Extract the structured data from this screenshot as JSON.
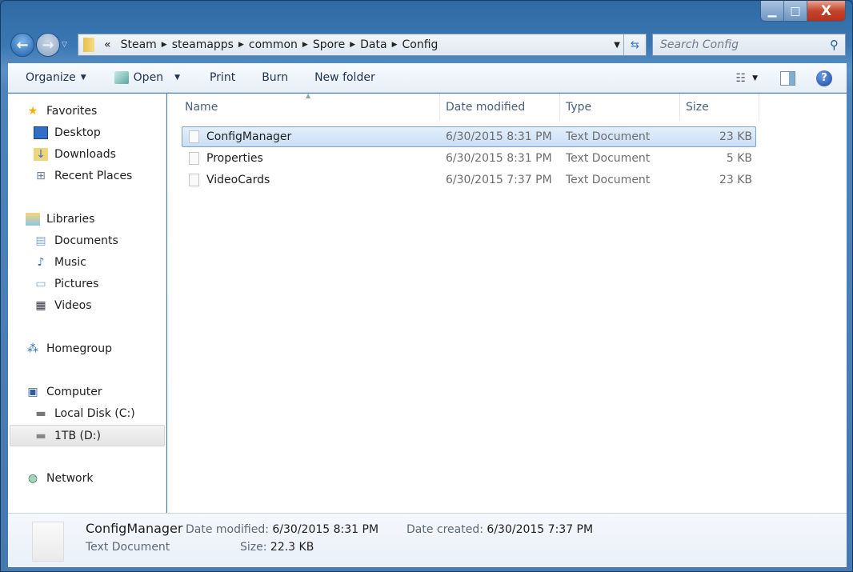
{
  "window": {
    "controls": {
      "minimize": "▁",
      "maximize": "□",
      "close": "X"
    }
  },
  "address": {
    "overflow": "«",
    "crumbs": [
      "Steam",
      "steamapps",
      "common",
      "Spore",
      "Data",
      "Config"
    ]
  },
  "search": {
    "placeholder": "Search Config"
  },
  "toolbar": {
    "organize": "Organize",
    "open": "Open",
    "print": "Print",
    "burn": "Burn",
    "new_folder": "New folder"
  },
  "nav": {
    "favorites": "Favorites",
    "desktop": "Desktop",
    "downloads": "Downloads",
    "recent": "Recent Places",
    "libraries": "Libraries",
    "documents": "Documents",
    "music": "Music",
    "pictures": "Pictures",
    "videos": "Videos",
    "homegroup": "Homegroup",
    "computer": "Computer",
    "local_disk": "Local Disk (C:)",
    "d_drive": "1TB (D:)",
    "network": "Network"
  },
  "columns": {
    "name": "Name",
    "date": "Date modified",
    "type": "Type",
    "size": "Size"
  },
  "files": [
    {
      "name": "ConfigManager",
      "date": "6/30/2015 8:31 PM",
      "type": "Text Document",
      "size": "23 KB"
    },
    {
      "name": "Properties",
      "date": "6/30/2015 8:31 PM",
      "type": "Text Document",
      "size": "5 KB"
    },
    {
      "name": "VideoCards",
      "date": "6/30/2015 7:37 PM",
      "type": "Text Document",
      "size": "23 KB"
    }
  ],
  "details": {
    "name": "ConfigManager",
    "type": "Text Document",
    "date_modified_label": "Date modified:",
    "date_modified": "6/30/2015 8:31 PM",
    "date_created_label": "Date created:",
    "date_created": "6/30/2015 7:37 PM",
    "size_label": "Size:",
    "size": "22.3 KB"
  }
}
